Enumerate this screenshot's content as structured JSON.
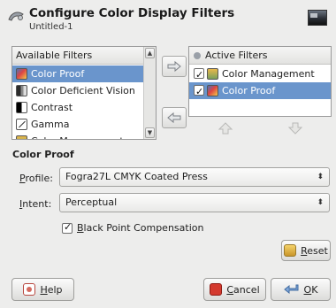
{
  "header": {
    "title": "Configure Color Display Filters",
    "subtitle": "Untitled-1"
  },
  "available": {
    "header": "Available Filters",
    "items": [
      {
        "label": "Color Proof",
        "icon": "color-proof-icon",
        "selected": true
      },
      {
        "label": "Color Deficient Vision",
        "icon": "color-deficient-vision-icon",
        "selected": false
      },
      {
        "label": "Contrast",
        "icon": "contrast-icon",
        "selected": false
      },
      {
        "label": "Gamma",
        "icon": "gamma-icon",
        "selected": false
      },
      {
        "label": "Color Management",
        "icon": "color-management-icon",
        "selected": false
      }
    ]
  },
  "active": {
    "header": "Active Filters",
    "items": [
      {
        "label": "Color Management",
        "checked": true,
        "selected": false
      },
      {
        "label": "Color Proof",
        "checked": true,
        "selected": true
      }
    ]
  },
  "section": {
    "title": "Color Proof",
    "profile": {
      "label_u": "P",
      "label_rest": "rofile:",
      "value": "Fogra27L CMYK Coated Press"
    },
    "intent": {
      "label_u": "I",
      "label_rest": "ntent:",
      "value": "Perceptual"
    },
    "bpc": {
      "label_u": "B",
      "label_rest": "lack Point Compensation",
      "checked": true
    }
  },
  "buttons": {
    "reset_u": "R",
    "reset_rest": "eset",
    "help_u": "H",
    "help_rest": "elp",
    "cancel_u": "C",
    "cancel_rest": "ancel",
    "ok_u": "O",
    "ok_rest": "K"
  },
  "colors": {
    "selection": "#6a95cc",
    "background": "#ededec"
  }
}
